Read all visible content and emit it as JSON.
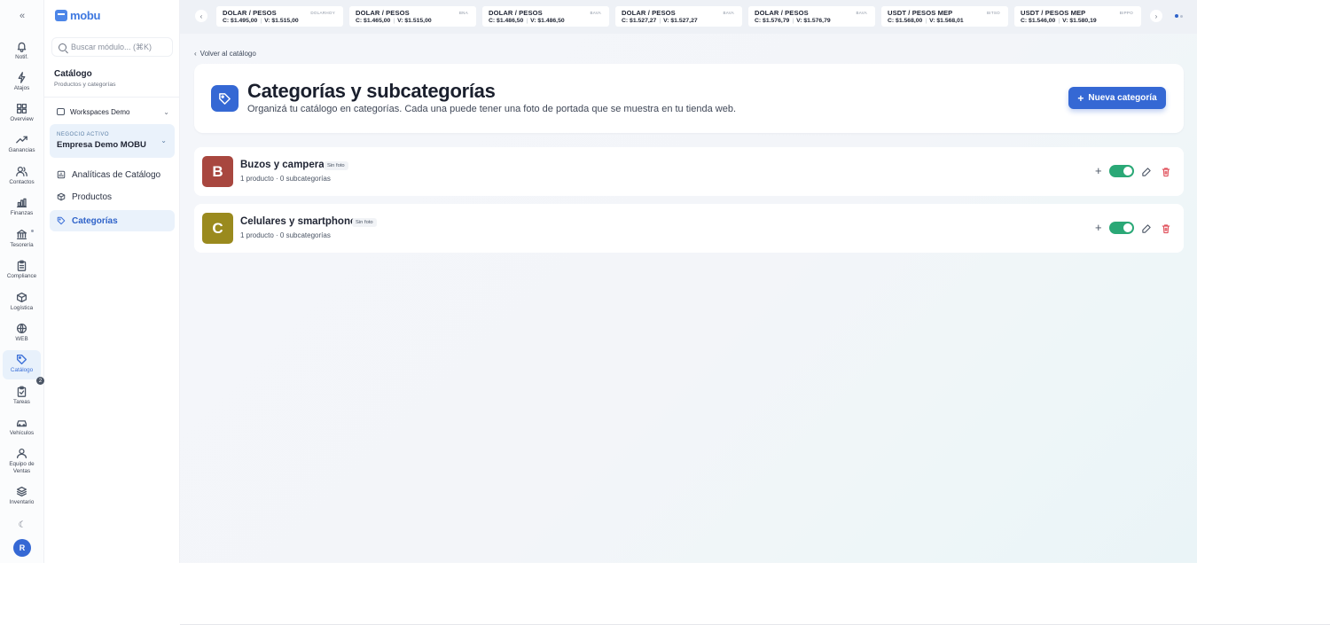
{
  "app": {
    "brand": "mobu"
  },
  "rail": {
    "items": [
      {
        "label": "Notif.",
        "icon": "bell-icon"
      },
      {
        "label": "Atajos",
        "icon": "shortcut-icon"
      },
      {
        "label": "Overview",
        "icon": "grid-icon"
      },
      {
        "label": "Ganancias",
        "icon": "trending-up-icon"
      },
      {
        "label": "Contactos",
        "icon": "contacts-icon"
      },
      {
        "label": "Finanzas",
        "icon": "chart-icon"
      },
      {
        "label": "Tesorería",
        "icon": "bank-icon"
      },
      {
        "label": "Compliance",
        "icon": "clipboard-icon"
      },
      {
        "label": "Logística",
        "icon": "box-icon"
      },
      {
        "label": "WEB",
        "icon": "globe-icon"
      },
      {
        "label": "Catálogo",
        "icon": "tag-icon"
      },
      {
        "label": "Tareas",
        "icon": "clipboard-check-icon"
      },
      {
        "label": "Vehículos",
        "icon": "car-icon"
      },
      {
        "label": "Equipo de Ventas",
        "icon": "team-icon"
      },
      {
        "label": "Inventario",
        "icon": "layers-icon"
      }
    ],
    "tasks_badge": "2",
    "avatar_initial": "R"
  },
  "sidebar": {
    "search_placeholder": "Buscar módulo... (⌘K)",
    "title": "Catálogo",
    "subtitle": "Productos y categorías",
    "workspace": "Workspaces Demo",
    "business_kicker": "NEGOCIO ACTIVO",
    "business_name": "Empresa Demo MOBU",
    "nav": [
      {
        "label": "Analíticas de Catálogo",
        "icon": "analytics-icon"
      },
      {
        "label": "Productos",
        "icon": "box-icon"
      },
      {
        "label": "Categorías",
        "icon": "tag-icon",
        "active": true
      }
    ]
  },
  "ticker": {
    "cards": [
      {
        "pair": "DOLAR / PESOS",
        "source": "DOLARHOY",
        "compra": "C: $1.495,00",
        "venta": "V: $1.515,00"
      },
      {
        "pair": "DOLAR / PESOS",
        "source": "BNA",
        "compra": "C: $1.465,00",
        "venta": "V: $1.515,00"
      },
      {
        "pair": "DOLAR / PESOS",
        "source": "BAVA",
        "compra": "C: $1.486,50",
        "venta": "V: $1.486,50"
      },
      {
        "pair": "DOLAR / PESOS",
        "source": "BAVA",
        "compra": "C: $1.527,27",
        "venta": "V: $1.527,27"
      },
      {
        "pair": "DOLAR / PESOS",
        "source": "BAVA",
        "compra": "C: $1.576,79",
        "venta": "V: $1.576,79"
      },
      {
        "pair": "USDT / PESOS MEP",
        "source": "BITSO",
        "compra": "C: $1.568,00",
        "venta": "V: $1.568,01"
      },
      {
        "pair": "USDT / PESOS MEP",
        "source": "BIPPO",
        "compra": "C: $1.546,00",
        "venta": "V: $1.580,19"
      }
    ]
  },
  "main": {
    "back_link": "Volver al catálogo",
    "title": "Categorías y subcategorías",
    "subtitle": "Organizá tu catálogo en categorías. Cada una puede tener una foto de portada que se muestra en tu tienda web.",
    "new_button": "Nueva categoría",
    "categories": [
      {
        "initial": "B",
        "name": "Buzos y camperas",
        "tag": "Sin foto",
        "meta": "1 producto · 0 subcategorías",
        "color": "#a8473f",
        "enabled": true
      },
      {
        "initial": "C",
        "name": "Celulares y smartphones",
        "tag": "Sin foto",
        "meta": "1 producto · 0 subcategorías",
        "color": "#9a8a1e",
        "enabled": true
      }
    ]
  }
}
